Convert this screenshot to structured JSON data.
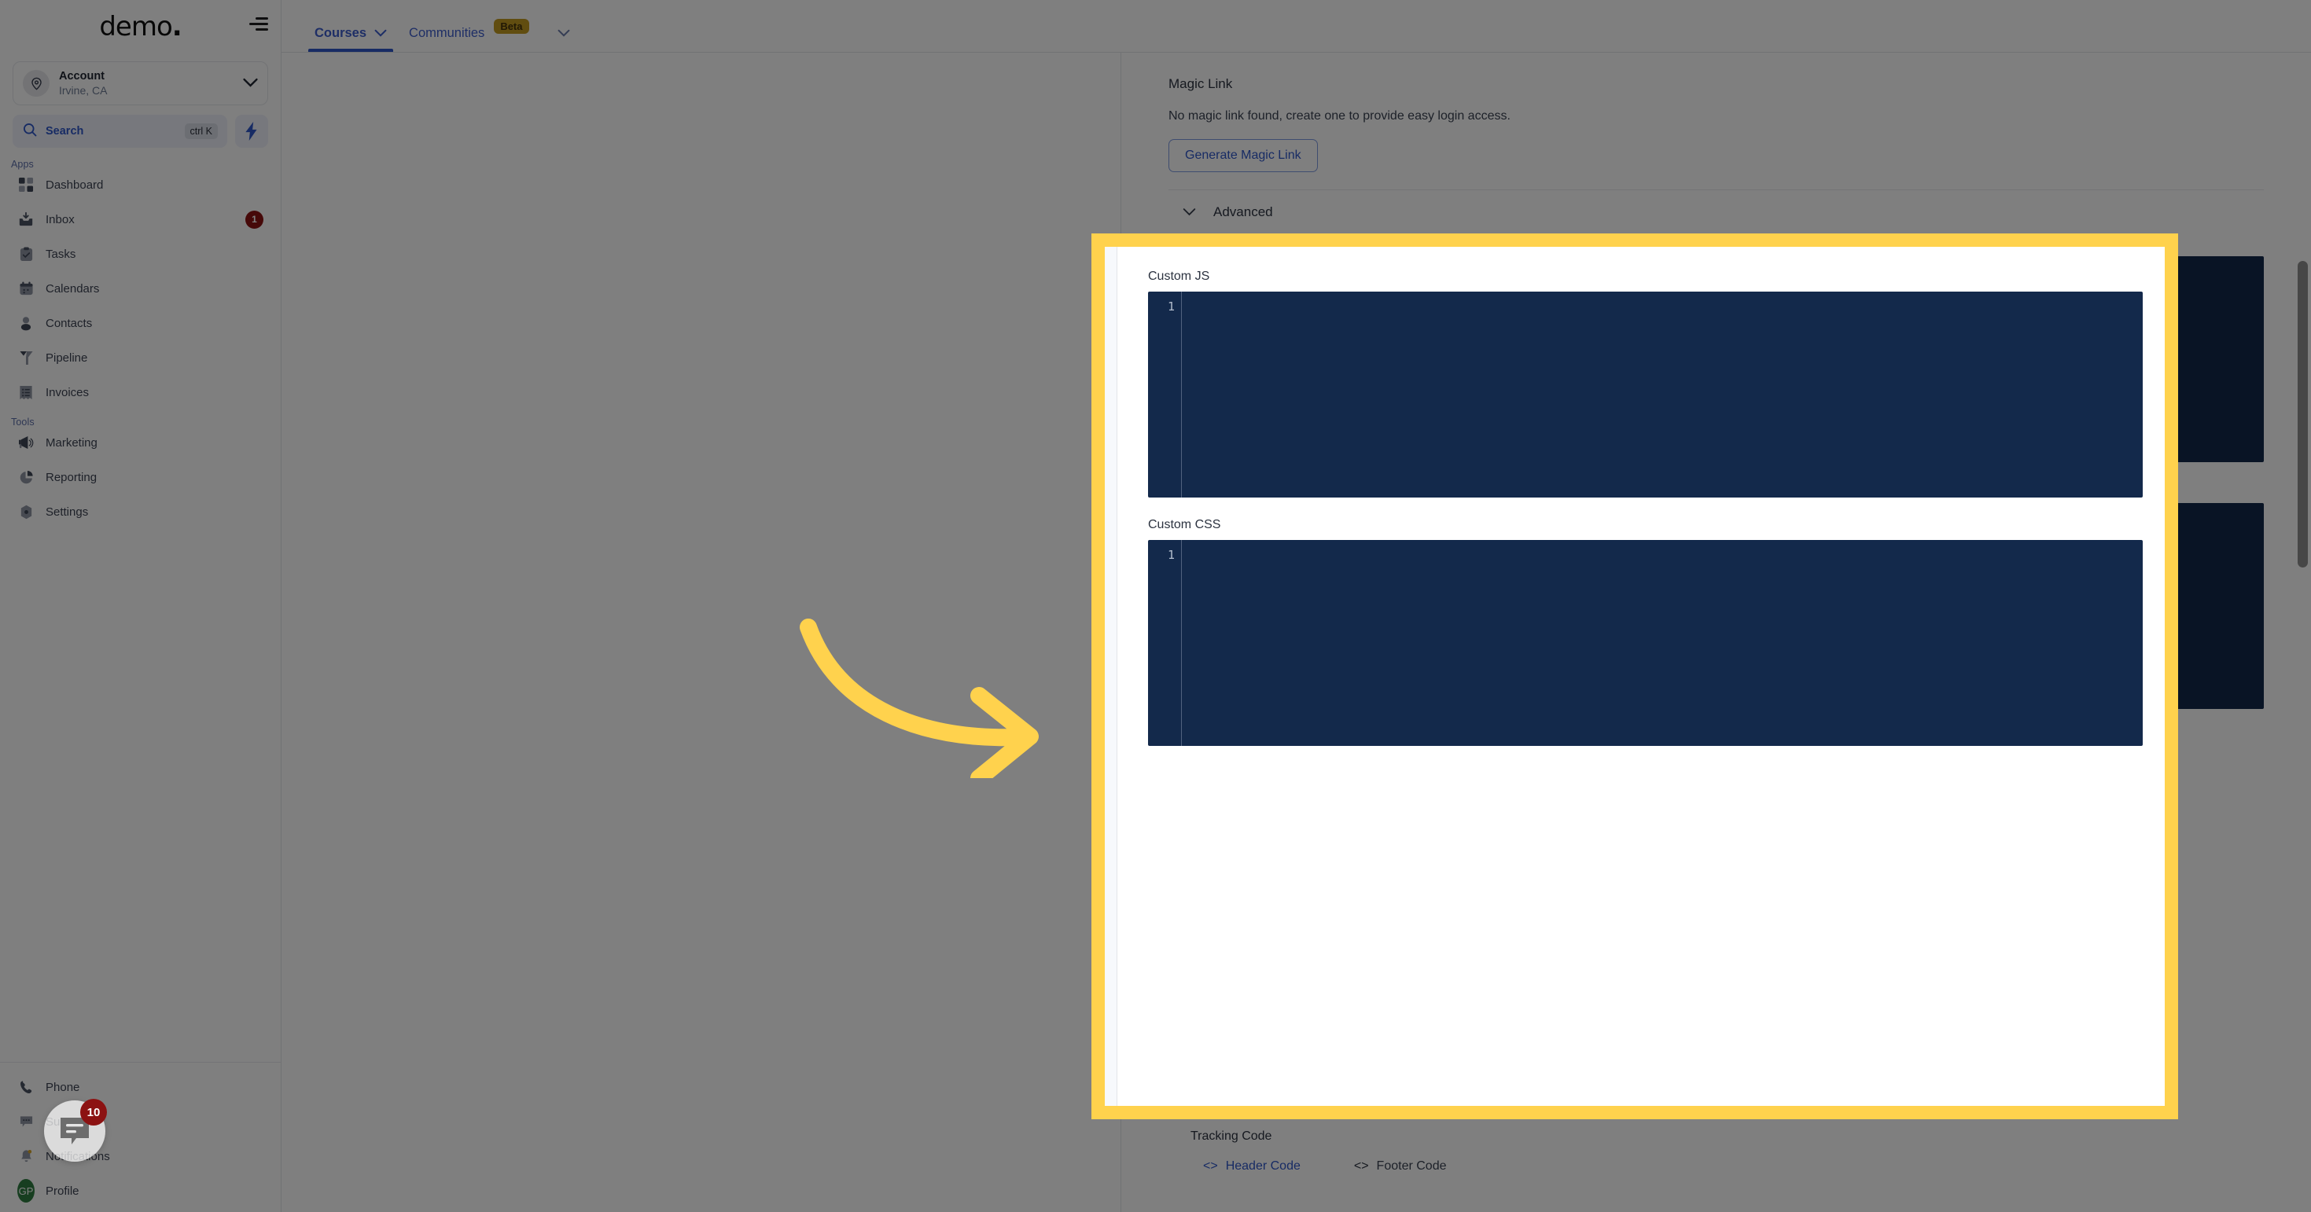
{
  "brand": {
    "name": "demo",
    "dot": "."
  },
  "sidebar": {
    "account": {
      "name": "Account",
      "location": "Irvine, CA"
    },
    "search": {
      "label": "Search",
      "shortcut": "ctrl K"
    },
    "sections": [
      {
        "label": "Apps",
        "items": [
          {
            "label": "Dashboard",
            "icon": "grid-icon",
            "badge": ""
          },
          {
            "label": "Inbox",
            "icon": "inbox-icon",
            "badge": "1"
          },
          {
            "label": "Tasks",
            "icon": "clipboard-check-icon",
            "badge": ""
          },
          {
            "label": "Calendars",
            "icon": "calendar-icon",
            "badge": ""
          },
          {
            "label": "Contacts",
            "icon": "person-icon",
            "badge": ""
          },
          {
            "label": "Pipeline",
            "icon": "funnel-icon",
            "badge": ""
          },
          {
            "label": "Invoices",
            "icon": "invoice-icon",
            "badge": ""
          }
        ]
      },
      {
        "label": "Tools",
        "items": [
          {
            "label": "Marketing",
            "icon": "megaphone-icon",
            "badge": ""
          },
          {
            "label": "Reporting",
            "icon": "pie-chart-icon",
            "badge": ""
          },
          {
            "label": "Settings",
            "icon": "gear-icon",
            "badge": ""
          }
        ]
      }
    ],
    "bottom": [
      {
        "label": "Phone",
        "icon": "phone-icon",
        "badge": ""
      },
      {
        "label": "Support",
        "icon": "chat-dots-icon",
        "badge": ""
      },
      {
        "label": "Notifications",
        "icon": "bell-icon",
        "badge": ""
      },
      {
        "label": "Profile",
        "icon": "avatar-icon",
        "badge": "",
        "avatar_initials": "GP"
      }
    ]
  },
  "topbar": {
    "tabs": [
      {
        "label": "Courses",
        "badge": "",
        "active": true,
        "caret": "⌄"
      },
      {
        "label": "Communities",
        "badge": "Beta",
        "active": false,
        "caret": "⌄"
      }
    ]
  },
  "main": {
    "magic_link": {
      "title": "Magic Link",
      "description": "No magic link found, create one to provide easy login access.",
      "button": "Generate Magic Link"
    },
    "advanced": {
      "label": "Advanced",
      "chevron": "⌄",
      "expanded": true
    },
    "custom_js": {
      "label": "Custom JS",
      "line_number": "1",
      "value": ""
    },
    "custom_css": {
      "label": "Custom CSS",
      "line_number": "1",
      "value": ""
    },
    "tracking": {
      "title": "Tracking Code",
      "links": [
        {
          "label": "Header Code",
          "icon": "code-brackets-icon",
          "style": "blue"
        },
        {
          "label": "Footer Code",
          "icon": "code-brackets-icon",
          "style": "dark"
        }
      ]
    }
  },
  "annotations": {
    "highlight_color": "#ffd24d",
    "arrow": {
      "color": "#ffd24d",
      "direction": "curved-right"
    }
  },
  "chat_widget": {
    "badge": "10",
    "icon": "chat-bubble-icon"
  },
  "colors": {
    "accent_blue": "#2f57c9",
    "editor_bg": "#13294b",
    "badge_red": "#8c1212",
    "beta_gold": "#c39a20",
    "avatar_green": "#2f7d41"
  }
}
